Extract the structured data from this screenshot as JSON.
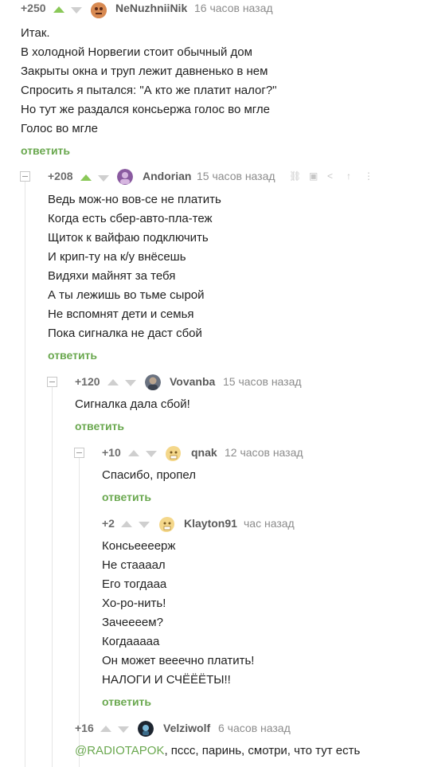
{
  "colors": {
    "accent": "#8ac858",
    "reply": "#6aa84f",
    "meta": "#8c8c8c"
  },
  "comments": [
    {
      "rating": "+250",
      "author": "NeNuzhniiNik",
      "time": "16 часов назад",
      "lines": [
        "Итак.",
        "В холодной Норвегии стоит обычный дом",
        "Закрыты окна и труп лежит давненько в нем",
        "Спросить я пытался: \"А кто же платит налог?\"",
        "Но тут же раздался консьержа голос во мгле",
        "Голос во мгле"
      ],
      "reply": "ответить"
    },
    {
      "rating": "+208",
      "author": "Andorian",
      "time": "15 часов назад",
      "lines": [
        "Ведь мож-но вов-се не платить",
        "Когда есть сбер-авто-пла-теж",
        "Щиток к вайфаю подключить",
        "И крип-ту на к/у внёсешь",
        "Видяхи майнят за тебя",
        "А ты лежишь во тьме сырой",
        "Не вспомнят дети и семья",
        "Пока сигналка не даст сбой"
      ],
      "reply": "ответить",
      "tools": [
        "link-icon",
        "save-icon",
        "share-icon",
        "up-to-parent-icon",
        "more-icon"
      ]
    },
    {
      "rating": "+120",
      "author": "Vovanba",
      "time": "15 часов назад",
      "lines": [
        "Сигналка дала сбой!"
      ],
      "reply": "ответить"
    },
    {
      "rating": "+10",
      "author": "qnak",
      "time": "12 часов назад",
      "lines": [
        "Спасибо, пропел"
      ],
      "reply": "ответить"
    },
    {
      "rating": "+2",
      "author": "Klayton91",
      "time": "час назад",
      "lines": [
        "Консьеееерж",
        "Не стааaал",
        "Его тогдааа",
        "Хо-ро-нить!",
        "Зачееeем?",
        "Когдааааа",
        "Он может вееечно платить!",
        "НАЛОГИ И СЧЁЁЁТЫ!!"
      ],
      "reply": "ответить"
    },
    {
      "rating": "+16",
      "author": "Velziwolf",
      "time": "6 часов назад",
      "mention": "@RADIOTAPOK",
      "text": ", пссс, паринь, смотри, что тут есть"
    }
  ]
}
